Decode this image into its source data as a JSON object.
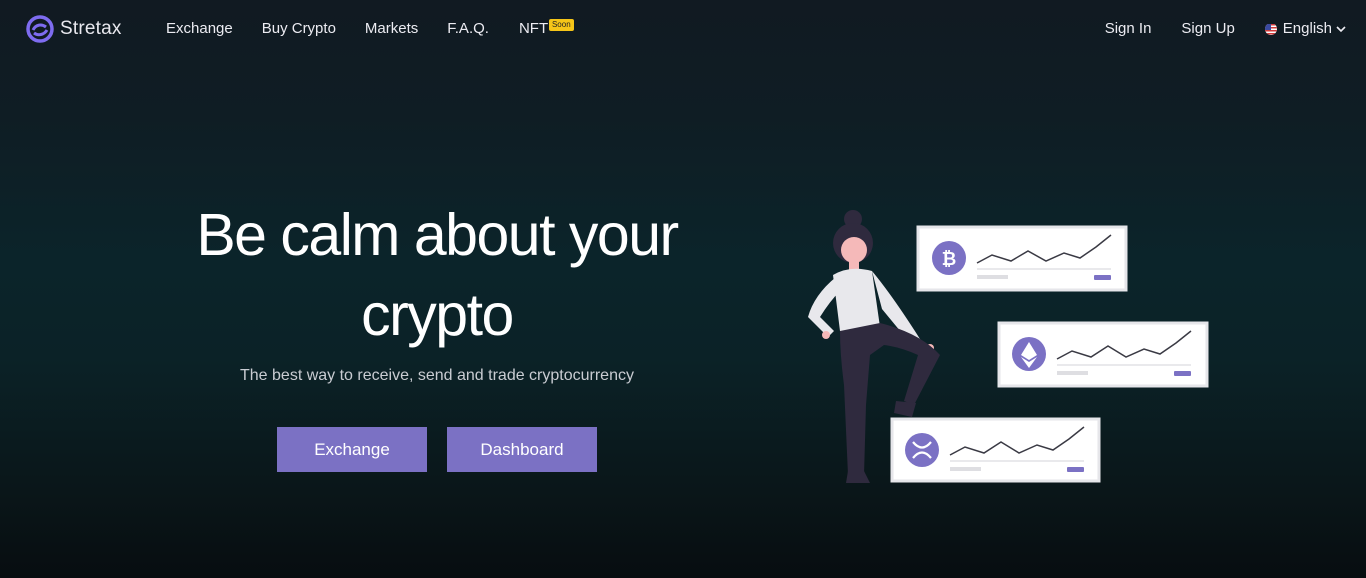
{
  "brand": {
    "name": "Stretax",
    "accent": "#7b71c4"
  },
  "nav": {
    "links": [
      {
        "label": "Exchange"
      },
      {
        "label": "Buy Crypto"
      },
      {
        "label": "Markets"
      },
      {
        "label": "F.A.Q."
      },
      {
        "label": "NFT",
        "badge": "Soon"
      }
    ],
    "sign_in": "Sign In",
    "sign_up": "Sign Up",
    "language": {
      "selected": "English",
      "icon": "us-flag-icon"
    }
  },
  "hero": {
    "title": "Be calm about your crypto",
    "subtitle": "The best way to receive, send and trade cryptocurrency",
    "buttons": {
      "exchange": "Exchange",
      "dashboard": "Dashboard"
    }
  },
  "illustration": {
    "cards": [
      {
        "coin": "bitcoin-icon"
      },
      {
        "coin": "ethereum-icon"
      },
      {
        "coin": "ripple-icon"
      }
    ]
  }
}
